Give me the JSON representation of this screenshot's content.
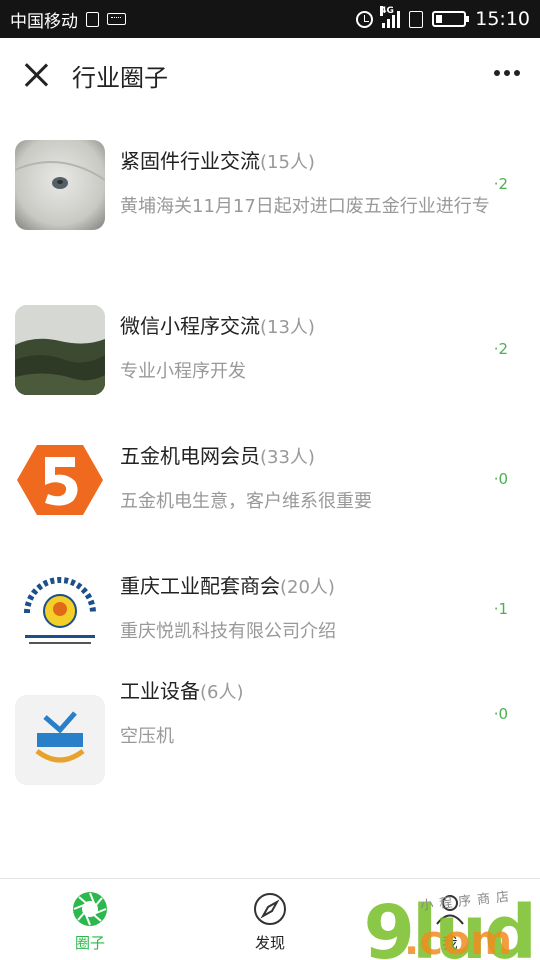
{
  "status_bar": {
    "carrier": "中国移动",
    "network": "4G",
    "time": "15:10"
  },
  "header": {
    "title": "行业圈子",
    "close_icon": "close-icon",
    "more_icon": "more-icon"
  },
  "groups": [
    {
      "name": "紧固件行业交流",
      "count": "(15人)",
      "desc": "黄埔海关11月17日起对进口废五金行业进行专",
      "badge": "·2"
    },
    {
      "name": "微信小程序交流",
      "count": "(13人)",
      "desc": "专业小程序开发",
      "badge": "·2"
    },
    {
      "name": "五金机电网会员",
      "count": "(33人)",
      "desc": "五金机电生意，客户维系很重要",
      "badge": "·0"
    },
    {
      "name": "重庆工业配套商会",
      "count": "(20人)",
      "desc": "重庆悦凯科技有限公司介绍",
      "badge": "·1"
    },
    {
      "name": "工业设备",
      "count": "(6人)",
      "desc": "空压机",
      "badge": "·0"
    }
  ],
  "tabs": [
    {
      "label": "圈子",
      "icon": "aperture-icon",
      "active": true
    },
    {
      "label": "发现",
      "icon": "compass-icon",
      "active": false
    },
    {
      "label": "我",
      "icon": "person-icon",
      "active": false
    }
  ],
  "watermark": {
    "text": "9lud",
    "domain": ".com",
    "small": "小程序商店"
  },
  "colors": {
    "accent_green": "#2db84d",
    "badge_green": "#4CAF50",
    "status_bar_bg": "#141414",
    "secondary_text": "#999999"
  }
}
